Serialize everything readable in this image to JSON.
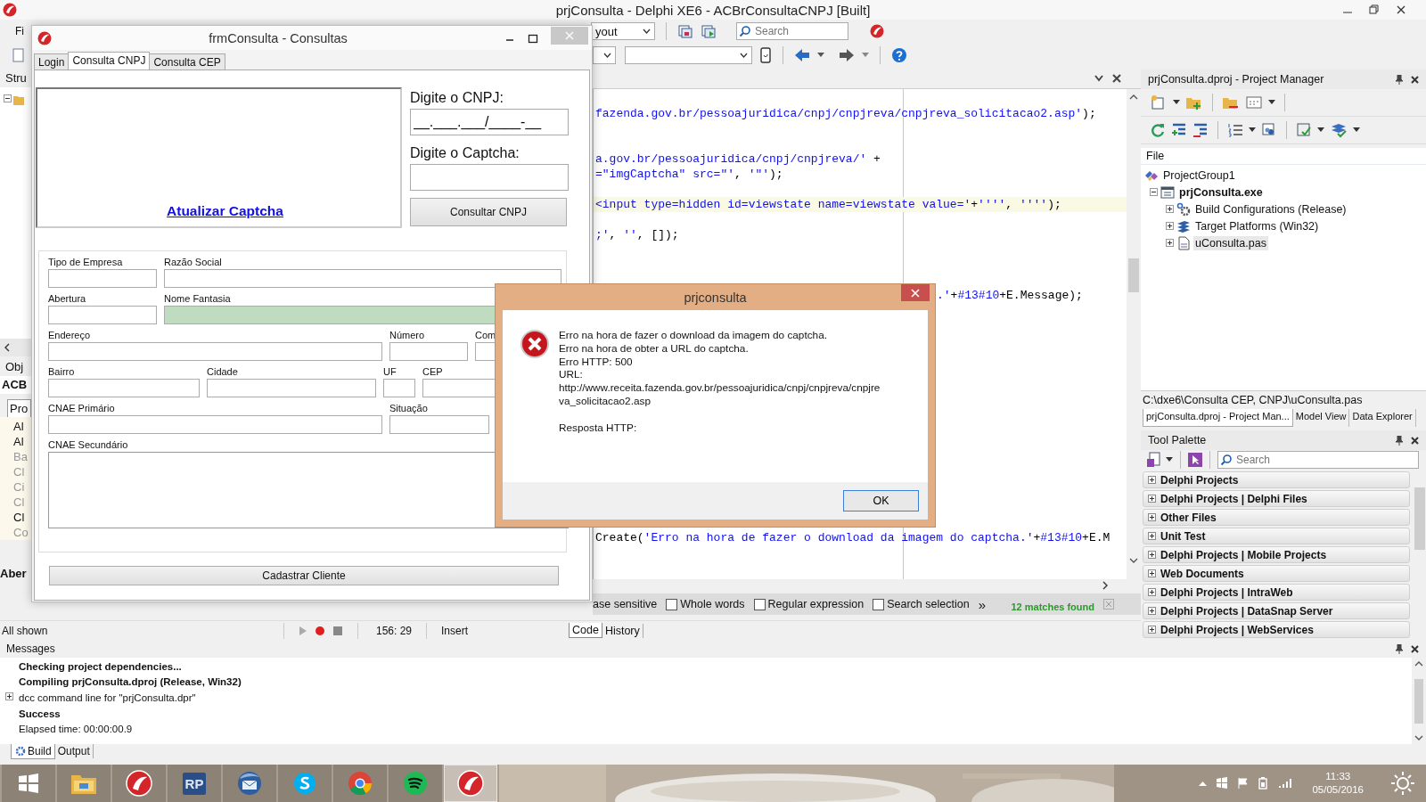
{
  "ide": {
    "title": "prjConsulta - Delphi XE6 - ACBrConsultaCNPJ [Built]",
    "menu_fragment": "Fi",
    "layout_combo": "yout",
    "search": {
      "placeholder": "Search"
    }
  },
  "structure": {
    "header": "Stru",
    "inspector_header": "Obj",
    "object_name": "ACB",
    "tab": "Pro",
    "items": [
      {
        "label": "Al",
        "dim": false
      },
      {
        "label": "Al",
        "dim": false
      },
      {
        "label": "Ba",
        "dim": true
      },
      {
        "label": "Cl",
        "dim": true
      },
      {
        "label": "Ci",
        "dim": true
      },
      {
        "label": "Cl",
        "dim": true
      },
      {
        "label": "Cl",
        "dim": false
      },
      {
        "label": "Co",
        "dim": true
      }
    ],
    "footer": "Aber"
  },
  "editor": {
    "code_lines": [
      {
        "kind": "code",
        "current": false,
        "segments": [
          {
            "text": "fazenda.gov.br/pessoajuridica/cnpj/cnpjreva/cnpjreva_solicitacao2.asp'",
            "string": true
          },
          {
            "text": ");",
            "string": false
          }
        ]
      },
      {
        "kind": "blank",
        "current": false
      },
      {
        "kind": "blank",
        "current": false
      },
      {
        "kind": "code",
        "current": false,
        "segments": [
          {
            "text": "a.gov.br/pessoajuridica/cnpj/cnpjreva/'",
            "string": true
          },
          {
            "text": " +",
            "string": false
          }
        ]
      },
      {
        "kind": "code",
        "current": false,
        "segments": [
          {
            "text": "=\"imgCaptcha\" src=\"'",
            "string": true
          },
          {
            "text": ", ",
            "string": false
          },
          {
            "text": "'\"'",
            "string": true
          },
          {
            "text": ");",
            "string": false
          }
        ]
      },
      {
        "kind": "blank",
        "current": false
      },
      {
        "kind": "code",
        "current": true,
        "segments": [
          {
            "text": "<input type=hidden id=viewstate name=viewstate value='",
            "string": true
          },
          {
            "text": "+",
            "string": false
          },
          {
            "text": "''''",
            "string": true
          },
          {
            "text": ", ",
            "string": false
          },
          {
            "text": "''''",
            "string": true
          },
          {
            "text": ");",
            "string": false
          }
        ]
      },
      {
        "kind": "blank",
        "current": false
      },
      {
        "kind": "code",
        "current": false,
        "segments": [
          {
            "text": ";'",
            "string": true
          },
          {
            "text": ", ",
            "string": false
          },
          {
            "text": "''",
            "string": true
          },
          {
            "text": ", []);",
            "string": false
          }
        ]
      },
      {
        "kind": "blank",
        "current": false
      },
      {
        "kind": "blank",
        "current": false
      },
      {
        "kind": "blank",
        "current": false
      },
      {
        "kind": "tail",
        "current": false,
        "segments": [
          {
            "text": ".'",
            "string": true
          },
          {
            "text": "+",
            "string": false
          },
          {
            "text": "#13#10",
            "string": true
          },
          {
            "text": "+E.Message);",
            "string": false
          }
        ]
      },
      {
        "kind": "blank",
        "current": false
      },
      {
        "kind": "blank",
        "current": false
      },
      {
        "kind": "blank",
        "current": false
      },
      {
        "kind": "blank",
        "current": false
      },
      {
        "kind": "blank",
        "current": false
      },
      {
        "kind": "blank",
        "current": false
      },
      {
        "kind": "blank",
        "current": false
      },
      {
        "kind": "blank",
        "current": false
      },
      {
        "kind": "blank",
        "current": false
      },
      {
        "kind": "blank",
        "current": false
      },
      {
        "kind": "blank",
        "current": false
      },
      {
        "kind": "blank",
        "current": false
      },
      {
        "kind": "blank",
        "current": false
      },
      {
        "kind": "blank",
        "current": false
      },
      {
        "kind": "blank",
        "current": false
      },
      {
        "kind": "code",
        "current": false,
        "segments": [
          {
            "text": "Create(",
            "string": false
          },
          {
            "text": "'Erro na hora de fazer o download da imagem do captcha.'",
            "string": true
          },
          {
            "text": "+",
            "string": false
          },
          {
            "text": "#13#10",
            "string": true
          },
          {
            "text": "+E.M",
            "string": false
          }
        ]
      }
    ],
    "find_bar": {
      "case_fragment": "ase sensitive",
      "options": [
        {
          "label": "Whole words",
          "checked": false
        },
        {
          "label": "Regular expression",
          "checked": false
        },
        {
          "label": "Search selection",
          "checked": false
        }
      ],
      "more": "»",
      "result": "12 matches found"
    },
    "status": {
      "filter": "All shown",
      "position": "156: 29",
      "mode": "Insert",
      "tabs": [
        {
          "label": "Code",
          "selected": true
        },
        {
          "label": "History",
          "selected": false
        }
      ]
    }
  },
  "project_manager": {
    "title": "prjConsulta.dproj - Project Manager",
    "column": "File",
    "tree": [
      {
        "label": "ProjectGroup1",
        "kind": "group",
        "children": [
          {
            "label": "prjConsulta.exe",
            "kind": "exe",
            "expanded": true,
            "selected": false,
            "children": [
              {
                "label": "Build Configurations (Release)",
                "kind": "config",
                "expanded": false,
                "selected": false
              },
              {
                "label": "Target Platforms (Win32)",
                "kind": "platforms",
                "expanded": false,
                "selected": false
              },
              {
                "label": "uConsulta.pas",
                "kind": "unit",
                "expanded": false,
                "selected": true
              }
            ]
          }
        ]
      }
    ],
    "path": "C:\\dxe6\\Consulta CEP, CNPJ\\uConsulta.pas",
    "tabs": [
      {
        "label": "prjConsulta.dproj - Project Man...",
        "selected": true
      },
      {
        "label": "Model View",
        "selected": false
      },
      {
        "label": "Data Explorer",
        "selected": false
      }
    ]
  },
  "tool_palette": {
    "title": "Tool Palette",
    "search": {
      "placeholder": "Search"
    },
    "categories": [
      {
        "label": "Delphi Projects",
        "expanded": false
      },
      {
        "label": "Delphi Projects | Delphi Files",
        "expanded": false
      },
      {
        "label": "Other Files",
        "expanded": false
      },
      {
        "label": "Unit Test",
        "expanded": false
      },
      {
        "label": "Delphi Projects | Mobile Projects",
        "expanded": false
      },
      {
        "label": "Web Documents",
        "expanded": false
      },
      {
        "label": "Delphi Projects | IntraWeb",
        "expanded": false
      },
      {
        "label": "Delphi Projects | DataSnap Server",
        "expanded": false
      },
      {
        "label": "Delphi Projects | WebServices",
        "expanded": false
      }
    ]
  },
  "messages": {
    "title": "Messages",
    "lines": [
      {
        "text": "Checking project dependencies...",
        "bold": true,
        "expandable": false
      },
      {
        "text": "Compiling prjConsulta.dproj (Release, Win32)",
        "bold": true,
        "expandable": false
      },
      {
        "text": "dcc command line for \"prjConsulta.dpr\"",
        "bold": false,
        "expandable": true
      },
      {
        "text": "Success",
        "bold": true,
        "expandable": false
      },
      {
        "text": "Elapsed time: 00:00:00.9",
        "bold": false,
        "expandable": false
      }
    ],
    "tabs": [
      {
        "label": "Build",
        "selected": true
      },
      {
        "label": "Output",
        "selected": false
      }
    ]
  },
  "taskbar": {
    "apps": [
      {
        "kind": "windows",
        "active": false
      },
      {
        "kind": "explorer",
        "active": false
      },
      {
        "kind": "delphi",
        "active": false
      },
      {
        "kind": "rp",
        "label": "RP",
        "active": false
      },
      {
        "kind": "thunderbird",
        "active": false
      },
      {
        "kind": "skype",
        "active": false
      },
      {
        "kind": "chrome",
        "active": false
      },
      {
        "kind": "spotify",
        "active": false
      },
      {
        "kind": "delphi",
        "active": true
      }
    ],
    "time": "11:33",
    "date": "05/05/2016"
  },
  "form": {
    "title": "frmConsulta - Consultas",
    "tabs": [
      {
        "label": "Login",
        "selected": false
      },
      {
        "label": "Consulta CNPJ",
        "selected": true
      },
      {
        "label": "Consulta CEP",
        "selected": false
      }
    ],
    "captcha_link": "Atualizar Captcha",
    "cnpj_label": "Digite o CNPJ:",
    "cnpj_value": "__.___.___/____-__",
    "captcha_label": "Digite o Captcha:",
    "consult_button": "Consultar CNPJ",
    "field_rows": [
      [
        {
          "label": "Tipo de Empresa",
          "kind": "text",
          "focused": false
        },
        {
          "label": "Razão Social",
          "kind": "text",
          "focused": false
        }
      ],
      [
        {
          "label": "Abertura",
          "kind": "text",
          "focused": false
        },
        {
          "label": "Nome Fantasia",
          "kind": "text",
          "focused": true
        }
      ],
      [
        {
          "label": "Endereço",
          "kind": "text",
          "focused": false
        },
        {
          "label": "Número",
          "kind": "text",
          "focused": false
        },
        {
          "label": "Com",
          "kind": "text",
          "focused": false
        }
      ],
      [
        {
          "label": "Bairro",
          "kind": "text",
          "focused": false
        },
        {
          "label": "Cidade",
          "kind": "text",
          "focused": false
        },
        {
          "label": "UF",
          "kind": "text",
          "focused": false
        },
        {
          "label": "CEP",
          "kind": "text",
          "focused": false
        }
      ],
      [
        {
          "label": "CNAE Primário",
          "kind": "text",
          "focused": false
        },
        {
          "label": "Situação",
          "kind": "text",
          "focused": false
        }
      ],
      [
        {
          "label": "CNAE Secundário",
          "kind": "memo",
          "focused": false
        }
      ]
    ],
    "register_button": "Cadastrar Cliente"
  },
  "dialog": {
    "title": "prjconsulta",
    "message": "Erro na hora de fazer o download da imagem do captcha.\nErro na hora de obter a URL do captcha.\nErro HTTP: 500\nURL:\nhttp://www.receita.fazenda.gov.br/pessoajuridica/cnpj/cnpjreva/cnpjre\nva_solicitacao2.asp\n\nResposta HTTP:",
    "button": "OK"
  }
}
